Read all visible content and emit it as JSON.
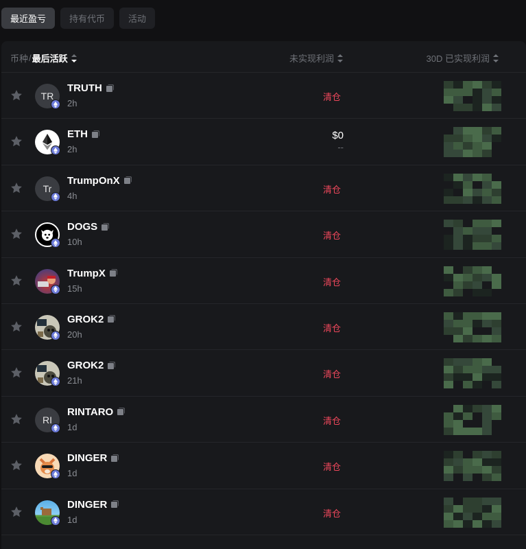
{
  "tabs": [
    {
      "label": "最近盈亏",
      "active": true
    },
    {
      "label": "持有代币",
      "active": false
    },
    {
      "label": "活动",
      "active": false
    }
  ],
  "header": {
    "coin": "币种",
    "separator": "/",
    "last_active": "最后活跃",
    "unrealized": "未实现利润",
    "realized_30d": "30D 已实现利润"
  },
  "rows": [
    {
      "name": "TRUTH",
      "time": "2h",
      "avatar": "TR",
      "avatar_kind": "text",
      "unrealized": "清仓"
    },
    {
      "name": "ETH",
      "time": "2h",
      "avatar": "",
      "avatar_kind": "eth",
      "unrealized_value": "$0",
      "unrealized_sub": "--"
    },
    {
      "name": "TrumpOnX",
      "time": "4h",
      "avatar": "Tr",
      "avatar_kind": "text",
      "unrealized": "清仓"
    },
    {
      "name": "DOGS",
      "time": "10h",
      "avatar": "",
      "avatar_kind": "dogs",
      "unrealized": "清仓"
    },
    {
      "name": "TrumpX",
      "time": "15h",
      "avatar": "",
      "avatar_kind": "trumpx",
      "unrealized": "清仓"
    },
    {
      "name": "GROK2",
      "time": "20h",
      "avatar": "",
      "avatar_kind": "grok",
      "unrealized": "清仓"
    },
    {
      "name": "GROK2",
      "time": "21h",
      "avatar": "",
      "avatar_kind": "grok",
      "unrealized": "清仓"
    },
    {
      "name": "RINTARO",
      "time": "1d",
      "avatar": "RI",
      "avatar_kind": "text",
      "unrealized": "清仓"
    },
    {
      "name": "DINGER",
      "time": "1d",
      "avatar": "",
      "avatar_kind": "dinger",
      "unrealized": "清仓"
    },
    {
      "name": "DINGER",
      "time": "1d",
      "avatar": "",
      "avatar_kind": "dinger2",
      "unrealized": "清仓"
    }
  ],
  "colors": {
    "sell_red": "#f0485c",
    "chain_badge": "#6c7bd9",
    "blur_green": "#3f5b40"
  }
}
